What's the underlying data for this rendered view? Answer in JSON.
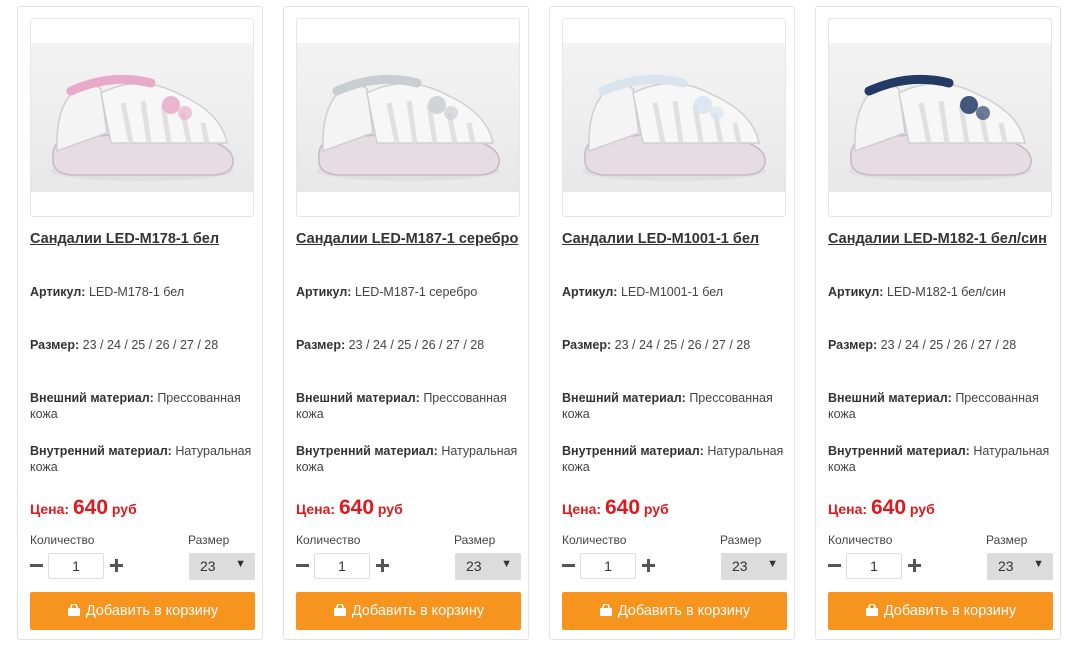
{
  "labels": {
    "article": "Артикул:",
    "size": "Размер:",
    "outer_material": "Внешний материал:",
    "inner_material": "Внутренний материал:",
    "price": "Цена:",
    "currency": "руб",
    "quantity": "Количество",
    "size_select": "Размер",
    "add_to_cart": "Добавить в корзину"
  },
  "colors": {
    "price": "#e0191f",
    "cart_button": "#f7941d"
  },
  "products": [
    {
      "title": "Сандалии LED-M178-1 бел",
      "article": "LED-M178-1 бел",
      "sizes": "23 / 24 / 25 / 26 / 27 / 28",
      "outer_material": "Прессованная кожа",
      "inner_material": "Натуральная кожа",
      "price": "640",
      "quantity": "1",
      "selected_size": "23",
      "accent": "#e9a9c9"
    },
    {
      "title": "Сандалии LED-M187-1 серебро",
      "article": "LED-M187-1 серебро",
      "sizes": "23 / 24 / 25 / 26 / 27 / 28",
      "outer_material": "Прессованная кожа",
      "inner_material": "Натуральная кожа",
      "price": "640",
      "quantity": "1",
      "selected_size": "23",
      "accent": "#c9cdd1"
    },
    {
      "title": "Сандалии LED-M1001-1 бел",
      "article": "LED-M1001-1 бел",
      "sizes": "23 / 24 / 25 / 26 / 27 / 28",
      "outer_material": "Прессованная кожа",
      "inner_material": "Натуральная кожа",
      "price": "640",
      "quantity": "1",
      "selected_size": "23",
      "accent": "#d9e4ee"
    },
    {
      "title": "Сандалии LED-M182-1 бел/син",
      "article": "LED-M182-1 бел/син",
      "sizes": "23 / 24 / 25 / 26 / 27 / 28",
      "outer_material": "Прессованная кожа",
      "inner_material": "Натуральная кожа",
      "price": "640",
      "quantity": "1",
      "selected_size": "23",
      "accent": "#233a66"
    }
  ]
}
